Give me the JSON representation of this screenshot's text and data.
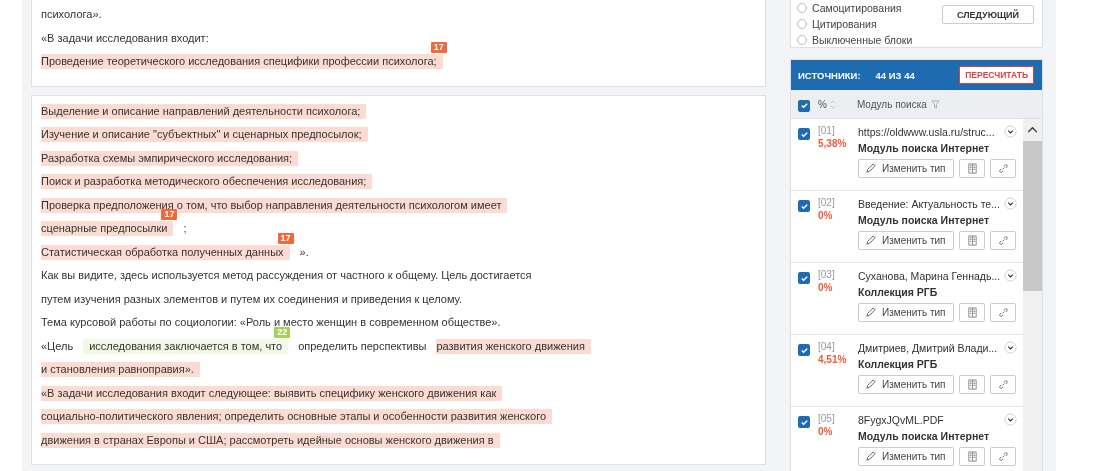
{
  "document": {
    "blocks": [
      {
        "lines": [
          {
            "segments": [
              {
                "text": "психолога».",
                "kind": "plain"
              }
            ]
          },
          {
            "segments": [
              {
                "text": "«В задачи исследования входит:",
                "kind": "plain"
              }
            ]
          },
          {
            "segments": [
              {
                "text": "Проведение теоретического исследования специфики профессии психолога;",
                "kind": "match",
                "badge": {
                  "text": "17",
                  "kind": "match"
                }
              }
            ]
          }
        ]
      },
      {
        "lines": [
          {
            "segments": [
              {
                "text": "Выделение и описание направлений деятельности психолога;",
                "kind": "match"
              }
            ]
          },
          {
            "segments": [
              {
                "text": "Изучение и описание \"субъектных\" и сценарных предпосылок;",
                "kind": "match"
              }
            ]
          },
          {
            "segments": [
              {
                "text": "Разработка схемы эмпирического исследования;",
                "kind": "match"
              }
            ]
          },
          {
            "segments": [
              {
                "text": "Поиск и разработка методического обеспечения исследования;",
                "kind": "match"
              }
            ]
          },
          {
            "segments": [
              {
                "text": "Проверка предположения о том, что выбор направления деятельности психологом имеет",
                "kind": "match"
              }
            ]
          },
          {
            "segments": [
              {
                "text": "сценарные предпосылки",
                "kind": "match",
                "badge": {
                  "text": "17",
                  "kind": "match"
                }
              },
              {
                "text": ";",
                "kind": "plain"
              }
            ]
          },
          {
            "segments": [
              {
                "text": "Статистическая обработка полученных данных",
                "kind": "match",
                "badge": {
                  "text": "17",
                  "kind": "match"
                }
              },
              {
                "text": "».",
                "kind": "plain"
              }
            ]
          },
          {
            "segments": [
              {
                "text": "Как вы видите, здесь используется метод рассуждения от частного к общему. Цель достигается",
                "kind": "plain"
              }
            ]
          },
          {
            "segments": [
              {
                "text": "путем изучения разных элементов и путем их соединения и приведения к целому.",
                "kind": "plain"
              }
            ]
          },
          {
            "segments": [
              {
                "text": "Тема курсовой работы по социологии: «Роль и место женщин в современном обществе».",
                "kind": "plain"
              }
            ]
          },
          {
            "segments": [
              {
                "text": "«Цель",
                "kind": "plain"
              },
              {
                "text": "исследования заключается в том, что",
                "kind": "cite",
                "badge": {
                  "text": "22",
                  "kind": "cite"
                }
              },
              {
                "text": "определить перспективы",
                "kind": "plain"
              },
              {
                "text": "развития женского движения",
                "kind": "match"
              }
            ]
          },
          {
            "segments": [
              {
                "text": "и становления равноправия».",
                "kind": "match"
              }
            ]
          },
          {
            "segments": [
              {
                "text": "«В задачи исследования входит следующее: выявить специфику женского движения как",
                "kind": "match"
              }
            ]
          },
          {
            "segments": [
              {
                "text": "социально-политического явления; определить основные этапы и особенности развития женского",
                "kind": "match"
              }
            ]
          },
          {
            "segments": [
              {
                "text": "движения в странах Европы и США; рассмотреть идейные основы женского движения в",
                "kind": "match"
              }
            ]
          }
        ]
      }
    ]
  },
  "filter": {
    "options": [
      {
        "label": "Самоцитирования",
        "selected": false
      },
      {
        "label": "Цитирования",
        "selected": false
      },
      {
        "label": "Выключенные блоки",
        "selected": false
      }
    ],
    "next_button": "СЛЕДУЮЩИЙ"
  },
  "sources": {
    "title": "ИСТОЧНИКИ:",
    "count": "44 ИЗ 44",
    "recalc_button": "ПЕРЕСЧИТАТЬ",
    "header": {
      "checked": true,
      "percent_label": "%",
      "module_label": "Модуль поиска"
    },
    "items": [
      {
        "checked": true,
        "num": "[01]",
        "percent": "5,38%",
        "title": "https://oldwww.usla.ru/struc...",
        "source": "Модуль поиска Интернет",
        "button": "Изменить тип"
      },
      {
        "checked": true,
        "num": "[02]",
        "percent": "0%",
        "title": "Введение: Актуальность те...",
        "source": "Модуль поиска Интернет",
        "button": "Изменить тип"
      },
      {
        "checked": true,
        "num": "[03]",
        "percent": "0%",
        "title": "Суханова, Марина Геннадь...",
        "source": "Коллекция РГБ",
        "button": "Изменить тип"
      },
      {
        "checked": true,
        "num": "[04]",
        "percent": "4,51%",
        "title": "Дмитриев, Дмитрий Влади...",
        "source": "Коллекция РГБ",
        "button": "Изменить тип"
      },
      {
        "checked": true,
        "num": "[05]",
        "percent": "0%",
        "title": "8FygxJQvML.PDF",
        "source": "Модуль поиска Интернет",
        "button": "Изменить тип"
      }
    ]
  }
}
